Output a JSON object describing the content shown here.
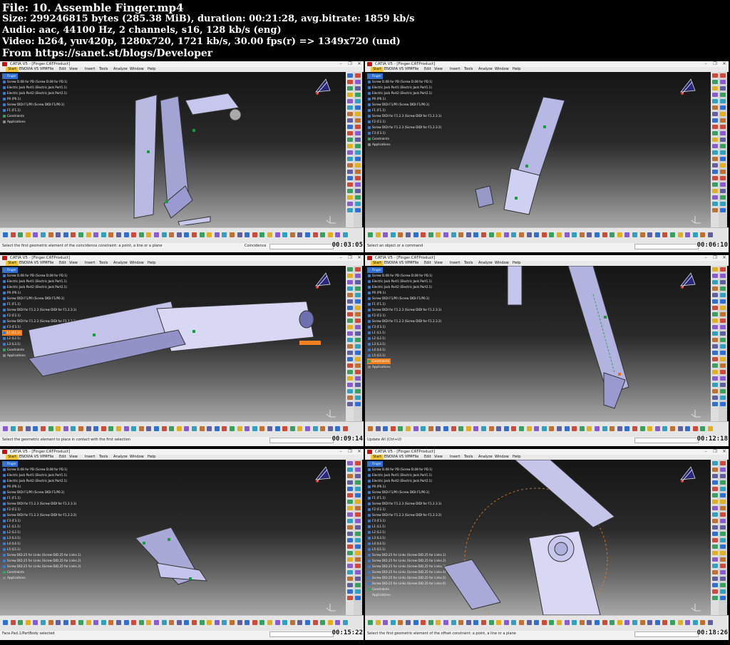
{
  "header": {
    "file": "File: 10. Assemble Finger.mp4",
    "size": "Size: 299246815 bytes (285.38 MiB), duration: 00:21:28, avg.bitrate: 1859 kb/s",
    "audio": "Audio: aac, 44100 Hz, 2 channels, s16, 128 kb/s (eng)",
    "video": "Video: h264, yuv420p, 1280x720, 1721 kb/s, 30.00 fps(r) => 1349x720 (und)",
    "source": "From https://sanet.st/blogs/Developer"
  },
  "window": {
    "title": "CATIA V5 - [Finger.CATProduct]",
    "min": "–",
    "max": "❐",
    "close": "✕"
  },
  "menu": [
    "Start",
    "ENOVIA V5 VPM",
    "File",
    "Edit",
    "View",
    "Insert",
    "Tools",
    "Analyze",
    "Window",
    "Help"
  ],
  "icons": {
    "compass": "compass-icon",
    "axis": "axis-triad-icon",
    "catia_logo": "catia-logo-icon"
  },
  "screens": [
    {
      "timecode": "00:03:05",
      "status": "Select the first geometric element of the coincidence constraint: a point, a line or a plane",
      "command": "Coincidence",
      "tree": [
        "Finger",
        "Screw D.08 for PD (Screw D.08 for PD.1)",
        "Electric Jack Part1 (Electric Jack Part1.1)",
        "Electric Jack Part2 (Electric Jack Part2.1)",
        "P0 (P0.1)",
        "Screw DIDI F1/P0 (Screw DIDI F1/P0.1)",
        "F1 (F1.1)",
        "Constraints",
        "Applications"
      ]
    },
    {
      "timecode": "00:06:10",
      "status": "Select an object or a command",
      "command": "",
      "tree": [
        "Finger",
        "Screw D.08 for PD (Screw D.08 for PD.1)",
        "Electric Jack Part1 (Electric Jack Part1.1)",
        "Electric Jack Part2 (Electric Jack Part2.1)",
        "P0 (P0.1)",
        "Screw DIDI F1/P0 (Screw DIDI F1/P0.1)",
        "F1 (F1.1)",
        "Screw DIDI for F1.2.3 (Screw DIDI for F1.2.3.1)",
        "F2 (F2.1)",
        "Screw DIDI for F1.2.3 (Screw DIDI for F1.2.3.2)",
        "F3 (F3.1)",
        "Constraints",
        "Applications"
      ]
    },
    {
      "timecode": "00:09:14",
      "status": "Select the geometric element to place in contact with the first selection",
      "command": "",
      "tree": [
        "Finger",
        "Screw D.08 for PD (Screw D.08 for PD.1)",
        "Electric Jack Part1 (Electric Jack Part1.1)",
        "Electric Jack Part2 (Electric Jack Part2.1)",
        "P0 (P0.1)",
        "Screw DIDI F1/P0 (Screw DIDI F1/P0.1)",
        "F1 (F1.1)",
        "Screw DIDI for F1.2.3 (Screw DIDI for F1.2.3.1)",
        "F2 (F2.1)",
        "Screw DIDI for F1.2.3 (Screw DIDI for F1.2.3.2)",
        "F3 (F3.1)",
        "L1 (L1.1)",
        "L2 (L2.1)",
        "L3 (L3.1)",
        "Constraints",
        "Applications"
      ],
      "highlight": 11
    },
    {
      "timecode": "00:12:18",
      "status": "Update All (Ctrl+U)",
      "command": "",
      "tree": [
        "Finger",
        "Screw D.08 for PD (Screw D.08 for PD.1)",
        "Electric Jack Part1 (Electric Jack Part1.1)",
        "Electric Jack Part2 (Electric Jack Part2.1)",
        "P0 (P0.1)",
        "Screw DIDI F1/P0 (Screw DIDI F1/P0.1)",
        "F1 (F1.1)",
        "Screw DIDI for F1.2.3 (Screw DIDI for F1.2.3.1)",
        "F2 (F2.1)",
        "Screw DIDI for F1.2.3 (Screw DIDI for F1.2.3.2)",
        "F3 (F3.1)",
        "L1 (L1.1)",
        "L2 (L2.1)",
        "L3 (L3.1)",
        "L4 (L4.1)",
        "L5 (L5.1)",
        "Constraints",
        "Applications"
      ],
      "highlight": 16
    },
    {
      "timecode": "00:15:22",
      "status": "Face.Pad.1/PartBody selected",
      "command": "",
      "tree": [
        "Finger",
        "Screw D.08 for PD (Screw D.08 for PD.1)",
        "Electric Jack Part1 (Electric Jack Part1.1)",
        "Electric Jack Part2 (Electric Jack Part2.1)",
        "P0 (P0.1)",
        "Screw DIDI F1/P0 (Screw DIDI F1/P0.1)",
        "F1 (F1.1)",
        "Screw DIDI for F1.2.3 (Screw DIDI for F1.2.3.1)",
        "F2 (F2.1)",
        "Screw DIDI for F1.2.3 (Screw DIDI for F1.2.3.2)",
        "F3 (F3.1)",
        "L1 (L1.1)",
        "L2 (L2.1)",
        "L3 (L3.1)",
        "L4 (L4.1)",
        "L5 (L5.1)",
        "Screw DID.25 for Links (Screw DID.25 for Links.1)",
        "Screw DID.25 for Links (Screw DID.25 for Links.2)",
        "Screw DID.25 for Links (Screw DID.25 for Links.3)",
        "Constraints",
        "Applications"
      ]
    },
    {
      "timecode": "00:18:26",
      "status": "Select the first geometric element of the offset constraint: a point, a line or a plane",
      "command": "",
      "tree": [
        "Finger",
        "Screw D.08 for PD (Screw D.08 for PD.1)",
        "Electric Jack Part1 (Electric Jack Part1.1)",
        "Electric Jack Part2 (Electric Jack Part2.1)",
        "P0 (P0.1)",
        "Screw DIDI F1/P0 (Screw DIDI F1/P0.1)",
        "F1 (F1.1)",
        "Screw DIDI for F1.2.3 (Screw DIDI for F1.2.3.1)",
        "F2 (F2.1)",
        "Screw DIDI for F1.2.3 (Screw DIDI for F1.2.3.2)",
        "F3 (F3.1)",
        "L1 (L1.1)",
        "L2 (L2.1)",
        "L3 (L3.1)",
        "L4 (L4.1)",
        "L5 (L5.1)",
        "Screw DID.25 for Links (Screw DID.25 for Links.1)",
        "Screw DID.25 for Links (Screw DID.25 for Links.2)",
        "Screw DID.25 for Links (Screw DID.25 for Links.3)",
        "Screw DID.25 for Links (Screw DID.25 for Links.4)",
        "Screw DID.25 for Links (Screw DID.25 for Links.5)",
        "Screw DID.25 for Links (Screw DID.25 for Links.6)",
        "Constraints",
        "Applications"
      ]
    }
  ]
}
